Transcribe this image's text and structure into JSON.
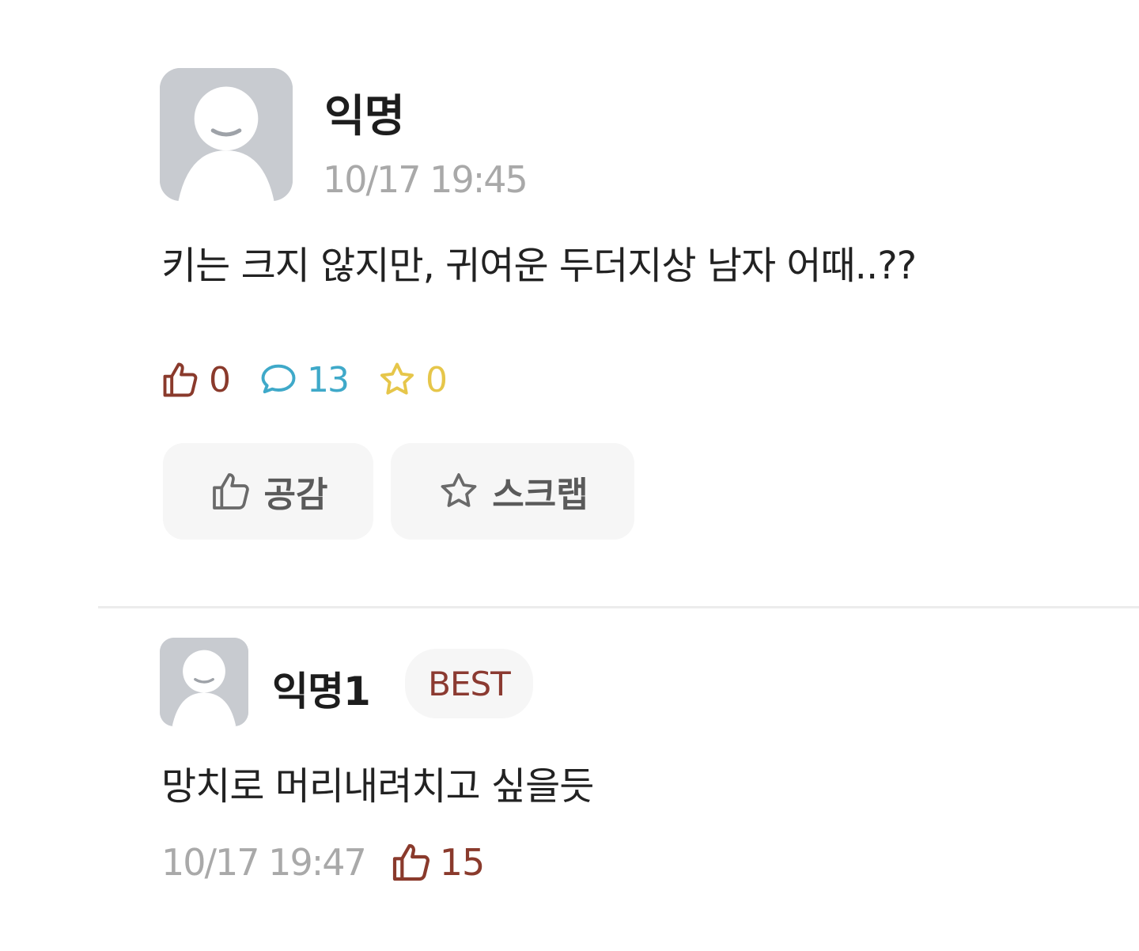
{
  "post": {
    "author": "익명",
    "time": "10/17 19:45",
    "body": "키는 크지 않지만, 귀여운 두더지상 남자 어때..??",
    "stats": {
      "likes": "0",
      "comments": "13",
      "scraps": "0"
    },
    "like_label": "공감",
    "scrap_label": "스크랩",
    "icons": {
      "like": "thumbs-up-icon",
      "comment": "speech-bubble-icon",
      "scrap": "star-icon",
      "avatar": "default-avatar-icon"
    }
  },
  "comment": {
    "author": "익명1",
    "badge": "BEST",
    "body": "망치로 머리내려치고 싶을듯",
    "time": "10/17 19:47",
    "likes": "15"
  },
  "colors": {
    "like": "#8a3a2c",
    "comment": "#3fa9c9",
    "scrap": "#e6c64a",
    "badge_text": "#8b3a31",
    "meta": "#a9a9a9"
  }
}
